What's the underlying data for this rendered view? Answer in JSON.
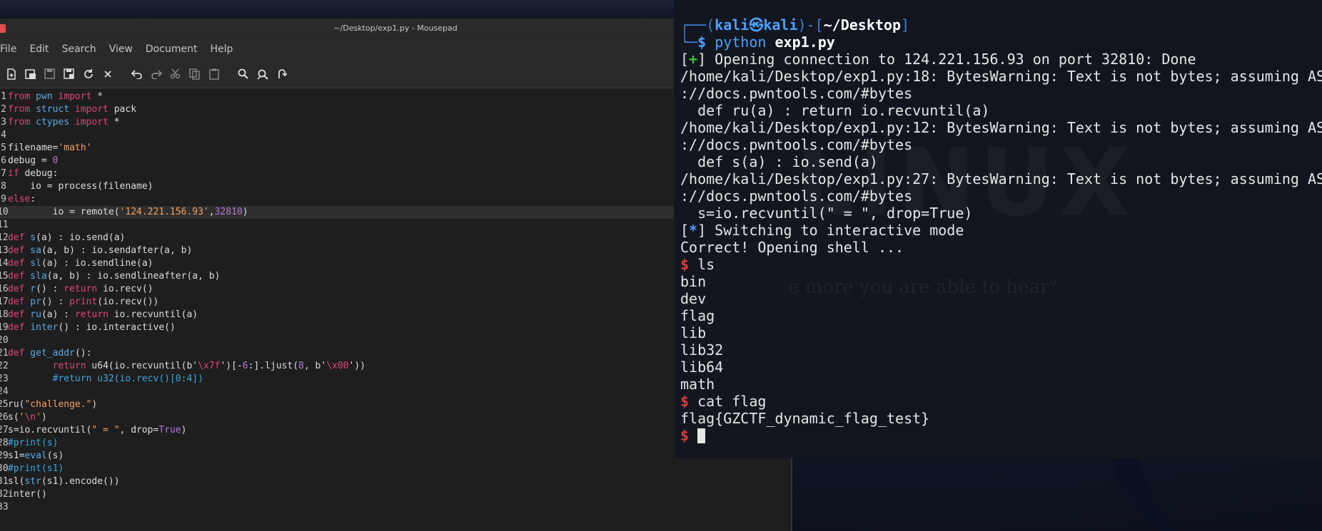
{
  "editor": {
    "title": "~/Desktop/exp1.py - Mousepad",
    "menu": [
      "File",
      "Edit",
      "Search",
      "View",
      "Document",
      "Help"
    ],
    "toolbar_icons": [
      "new-file-icon",
      "new-window-icon",
      "save-icon",
      "save-as-icon",
      "reload-icon",
      "close-icon",
      "undo-icon",
      "redo-icon",
      "cut-icon",
      "copy-icon",
      "paste-icon",
      "find-icon",
      "find-replace-icon",
      "goto-line-icon"
    ],
    "lines": [
      {
        "n": "1",
        "tokens": [
          [
            "k",
            "from"
          ],
          [
            "",
            ""
          ],
          [
            "m",
            " pwn"
          ],
          [
            "k",
            " import"
          ],
          [
            "",
            " *"
          ]
        ]
      },
      {
        "n": "2",
        "tokens": [
          [
            "k",
            "from"
          ],
          [
            "m",
            " struct"
          ],
          [
            "k",
            " import"
          ],
          [
            "",
            " pack"
          ]
        ]
      },
      {
        "n": "3",
        "tokens": [
          [
            "k",
            "from"
          ],
          [
            "m",
            " ctypes"
          ],
          [
            "k",
            " import"
          ],
          [
            "",
            " *"
          ]
        ]
      },
      {
        "n": "4",
        "tokens": []
      },
      {
        "n": "5",
        "tokens": [
          [
            "",
            "filename="
          ],
          [
            "s",
            "'math'"
          ]
        ]
      },
      {
        "n": "6",
        "tokens": [
          [
            "",
            "debug = "
          ],
          [
            "n",
            "0"
          ]
        ]
      },
      {
        "n": "7",
        "tokens": [
          [
            "k",
            "if"
          ],
          [
            "",
            " debug:"
          ]
        ]
      },
      {
        "n": "8",
        "tokens": [
          [
            "",
            "    io = process(filename)"
          ]
        ]
      },
      {
        "n": "9",
        "tokens": [
          [
            "k",
            "else"
          ],
          [
            "",
            ":"
          ]
        ]
      },
      {
        "n": "10",
        "tokens": [
          [
            "",
            "        io = remote("
          ],
          [
            "s",
            "'124.221.156.93'"
          ],
          [
            "",
            ","
          ],
          [
            "n",
            "32810"
          ],
          [
            "",
            ")"
          ]
        ],
        "current": true
      },
      {
        "n": "11",
        "tokens": []
      },
      {
        "n": "12",
        "tokens": [
          [
            "k",
            "def"
          ],
          [
            "f",
            " s"
          ],
          [
            "",
            "(a) : io.send(a)"
          ]
        ]
      },
      {
        "n": "13",
        "tokens": [
          [
            "k",
            "def"
          ],
          [
            "f",
            " sa"
          ],
          [
            "",
            "(a, b) : io.sendafter(a, b)"
          ]
        ]
      },
      {
        "n": "14",
        "tokens": [
          [
            "k",
            "def"
          ],
          [
            "f",
            " sl"
          ],
          [
            "",
            "(a) : io.sendline(a)"
          ]
        ]
      },
      {
        "n": "15",
        "tokens": [
          [
            "k",
            "def"
          ],
          [
            "f",
            " sla"
          ],
          [
            "",
            "(a, b) : io.sendlineafter(a, b)"
          ]
        ]
      },
      {
        "n": "16",
        "tokens": [
          [
            "k",
            "def"
          ],
          [
            "f",
            " r"
          ],
          [
            "",
            "() : "
          ],
          [
            "k",
            "return"
          ],
          [
            "",
            " io.recv()"
          ]
        ]
      },
      {
        "n": "17",
        "tokens": [
          [
            "k",
            "def"
          ],
          [
            "f",
            " pr"
          ],
          [
            "",
            "() : "
          ],
          [
            "k",
            "print"
          ],
          [
            "",
            "(io.recv())"
          ]
        ]
      },
      {
        "n": "18",
        "tokens": [
          [
            "k",
            "def"
          ],
          [
            "f",
            " ru"
          ],
          [
            "",
            "(a) : "
          ],
          [
            "k",
            "return"
          ],
          [
            "",
            " io.recvuntil(a)"
          ]
        ]
      },
      {
        "n": "19",
        "tokens": [
          [
            "k",
            "def"
          ],
          [
            "f",
            " inter"
          ],
          [
            "",
            "() : io.interactive()"
          ]
        ]
      },
      {
        "n": "20",
        "tokens": []
      },
      {
        "n": "21",
        "tokens": [
          [
            "k",
            "def"
          ],
          [
            "f",
            " get_addr"
          ],
          [
            "",
            "():"
          ]
        ]
      },
      {
        "n": "22",
        "tokens": [
          [
            "",
            "        "
          ],
          [
            "k",
            "return"
          ],
          [
            "",
            " u64(io.recvuntil(b'"
          ],
          [
            "k",
            "\\x7f"
          ],
          [
            "",
            "')[-"
          ],
          [
            "n",
            "6"
          ],
          [
            "",
            ":].ljust("
          ],
          [
            "n",
            "8"
          ],
          [
            "",
            ", b'"
          ],
          [
            "k",
            "\\x00"
          ],
          [
            "",
            "'))"
          ]
        ]
      },
      {
        "n": "23",
        "tokens": [
          [
            "",
            "        "
          ],
          [
            "c",
            "#return u32(io.recv()[0:4])"
          ]
        ]
      },
      {
        "n": "24",
        "tokens": []
      },
      {
        "n": "25",
        "tokens": [
          [
            "",
            "ru("
          ],
          [
            "s",
            "\"challenge.\""
          ],
          [
            "",
            ")"
          ]
        ]
      },
      {
        "n": "26",
        "tokens": [
          [
            "",
            "s("
          ],
          [
            "s",
            "'"
          ],
          [
            "k",
            "\\n"
          ],
          [
            "s",
            "'"
          ],
          [
            "",
            ")"
          ]
        ]
      },
      {
        "n": "27",
        "tokens": [
          [
            "",
            "s=io.recvuntil("
          ],
          [
            "s",
            "\" = \""
          ],
          [
            "",
            ", drop="
          ],
          [
            "n",
            "True"
          ],
          [
            "",
            ")"
          ]
        ]
      },
      {
        "n": "28",
        "tokens": [
          [
            "c",
            "#print(s)"
          ]
        ]
      },
      {
        "n": "29",
        "tokens": [
          [
            "",
            "s1="
          ],
          [
            "b",
            "eval"
          ],
          [
            "",
            "(s)"
          ]
        ]
      },
      {
        "n": "30",
        "tokens": [
          [
            "c",
            "#print(s1)"
          ]
        ]
      },
      {
        "n": "31",
        "tokens": [
          [
            "",
            "sl("
          ],
          [
            "b",
            "str"
          ],
          [
            "",
            "(s1).encode())"
          ]
        ]
      },
      {
        "n": "32",
        "tokens": [
          [
            "",
            "inter()"
          ]
        ]
      },
      {
        "n": "33",
        "tokens": []
      }
    ]
  },
  "terminal": {
    "prompt_user": "kali",
    "prompt_host": "kali",
    "prompt_at_glyph": "㉿",
    "prompt_path": "~/Desktop",
    "command": "python",
    "command_arg": "exp1.py",
    "output": [
      {
        "tag": "plus",
        "text": " Opening connection to 124.221.156.93 on port 32810: Done"
      },
      {
        "tag": "",
        "text": "/home/kali/Desktop/exp1.py:18: BytesWarning: Text is not bytes; assuming AS"
      },
      {
        "tag": "",
        "text": "://docs.pwntools.com/#bytes"
      },
      {
        "tag": "",
        "text": "  def ru(a) : return io.recvuntil(a)"
      },
      {
        "tag": "",
        "text": "/home/kali/Desktop/exp1.py:12: BytesWarning: Text is not bytes; assuming AS"
      },
      {
        "tag": "",
        "text": "://docs.pwntools.com/#bytes"
      },
      {
        "tag": "",
        "text": "  def s(a) : io.send(a)"
      },
      {
        "tag": "",
        "text": "/home/kali/Desktop/exp1.py:27: BytesWarning: Text is not bytes; assuming AS"
      },
      {
        "tag": "",
        "text": "://docs.pwntools.com/#bytes"
      },
      {
        "tag": "",
        "text": "  s=io.recvuntil(\" = \", drop=True)"
      },
      {
        "tag": "star",
        "text": " Switching to interactive mode"
      },
      {
        "tag": "",
        "text": "Correct! Opening shell ..."
      },
      {
        "tag": "dollar",
        "text": " ls"
      },
      {
        "tag": "",
        "text": "bin"
      },
      {
        "tag": "",
        "text": "dev"
      },
      {
        "tag": "",
        "text": "flag"
      },
      {
        "tag": "",
        "text": "lib"
      },
      {
        "tag": "",
        "text": "lib32"
      },
      {
        "tag": "",
        "text": "lib64"
      },
      {
        "tag": "",
        "text": "math"
      },
      {
        "tag": "dollar",
        "text": " cat flag"
      },
      {
        "tag": "",
        "text": "flag{GZCTF_dynamic_flag_test}"
      },
      {
        "tag": "dollar",
        "text": " "
      }
    ],
    "watermark": "LINUX",
    "watermark_tagline": "e more you are able to hear\""
  }
}
